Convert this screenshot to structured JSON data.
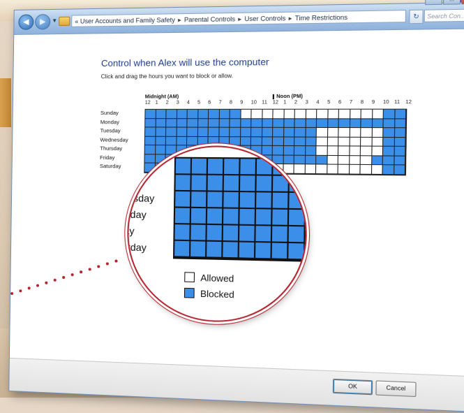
{
  "window": {
    "address_segments": [
      "User Accounts and Family Safety",
      "Parental Controls",
      "User Controls",
      "Time Restrictions"
    ],
    "search_placeholder": "Search Con...",
    "controls": [
      "—",
      "□",
      "✕"
    ]
  },
  "page": {
    "title": "Control when Alex will use the computer",
    "instruction": "Click and drag the hours you want to block or allow."
  },
  "grid": {
    "am_label": "Midnight (AM)",
    "pm_label": "Noon (PM)",
    "hours": [
      "12",
      "1",
      "2",
      "3",
      "4",
      "5",
      "6",
      "7",
      "8",
      "9",
      "10",
      "11",
      "12",
      "1",
      "2",
      "3",
      "4",
      "5",
      "6",
      "7",
      "8",
      "9",
      "10",
      "11",
      "12"
    ],
    "days": [
      "Sunday",
      "Monday",
      "Tuesday",
      "Wednesday",
      "Thursday",
      "Friday",
      "Saturday"
    ],
    "rows": [
      "BBBBBBBBBAAAAAAAAAAAAABB",
      "BBBBBBBBBBBBBBBBBBBBBBBB",
      "BBBBBBBBBBBBBBBBAAAAAABB",
      "BBBBBBBBBBBBBBBBAAAAAABB",
      "BBBBBBBBBBBBBBBBAAAAAABB",
      "BBBBBBBBBBBBBBBBBAAAABBB",
      "BBBBBBBBBAAAAAAAAAAAAABB"
    ]
  },
  "magnifier": {
    "days": [
      "lay",
      "nesday",
      "rsday",
      "lay",
      "urday"
    ],
    "legend": [
      {
        "label": "Allowed",
        "state": "allowed"
      },
      {
        "label": "Blocked",
        "state": "blocked"
      }
    ]
  },
  "buttons": {
    "ok": "OK",
    "cancel": "Cancel"
  },
  "colors": {
    "blocked": "#3b8fe9",
    "allowed": "#ffffff",
    "accent_title": "#1e3c8c",
    "magnifier_ring": "#b3232e"
  }
}
